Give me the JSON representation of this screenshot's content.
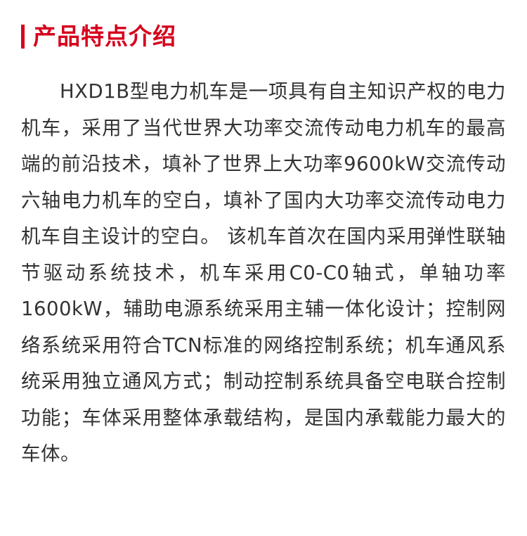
{
  "section": {
    "title": "产品特点介绍"
  },
  "colors": {
    "accent": "#d6001c",
    "text": "#333333"
  },
  "description": "HXD1B型电力机车是一项具有自主知识产权的电力机车，采用了当代世界大功率交流传动电力机车的最高端的前沿技术，填补了世界上大功率9600kW交流传动六轴电力机车的空白，填补了国内大功率交流传动电力机车自主设计的空白。 该机车首次在国内采用弹性联轴节驱动系统技术，机车采用C0-C0轴式，单轴功率1600kW，辅助电源系统采用主辅一体化设计；控制网络系统采用符合TCN标准的网络控制系统；机车通风系统采用独立通风方式；制动控制系统具备空电联合控制功能；车体采用整体承载结构，是国内承载能力最大的车体。"
}
